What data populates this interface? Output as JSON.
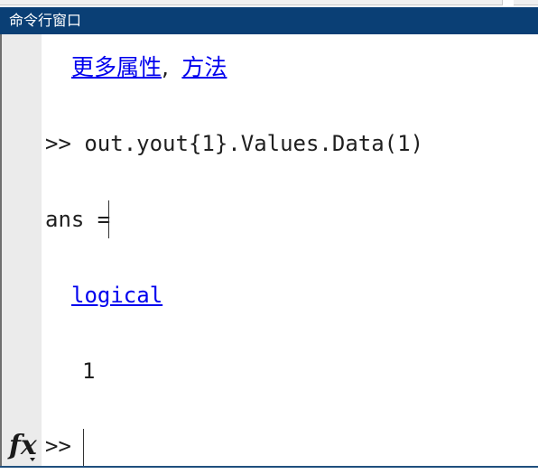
{
  "panel": {
    "title": "命令行窗口"
  },
  "lines": {
    "more_props": "更多属性",
    "comma": ",",
    "methods": "方法",
    "command": ">> out.yout{1}.Values.Data(1)",
    "ans": "ans =",
    "class_link": "logical",
    "value": "1",
    "prompt": ">>"
  },
  "icons": {
    "function_browser": "fx-icon"
  },
  "colors": {
    "title_bar": "#0a3f75",
    "link": "#0000ee",
    "gutter": "#ebebeb"
  }
}
